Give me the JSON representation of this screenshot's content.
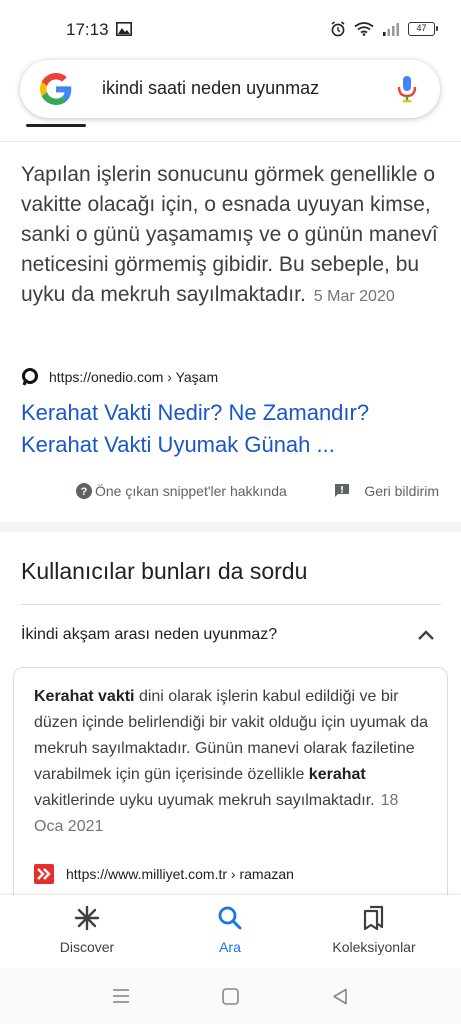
{
  "status_bar": {
    "time": "17:13",
    "battery": "47",
    "icons": [
      "image-icon",
      "alarm-icon",
      "wifi-icon",
      "signal-icon",
      "battery-icon"
    ]
  },
  "search": {
    "query": "ikindi saati neden uyunmaz",
    "logo": "google-g-logo",
    "mic": "mic-icon"
  },
  "featured_snippet": {
    "text": "Yapılan işlerin sonucunu görmek genellikle o vakitte olacağı için, o esnada uyuyan kimse, sanki o günü yaşamamış ve o günün manevî neticesini görmemiş gibidir. Bu sebeple, bu uyku da mekruh sayılmaktadır.",
    "date": "5 Mar 2020",
    "source_url": "https://onedio.com › Yaşam",
    "title": "Kerahat Vakti Nedir? Ne Zamandır? Kerahat Vakti Uyumak Günah ...",
    "about_label": "Öne çıkan snippet'ler hakkında",
    "feedback_label": "Geri bildirim"
  },
  "people_also_ask": {
    "title": "Kullanıcılar bunları da sordu",
    "question": "İkindi akşam arası neden uyunmaz?",
    "answer_b1": "Kerahat vakti",
    "answer_t1": " dini olarak işlerin kabul edildiği ve bir düzen içinde belirlendiği bir vakit olduğu için uyumak da mekruh sayılmaktadır. Günün manevi olarak faziletine varabilmek için gün içerisinde özellikle ",
    "answer_b2": "kerahat",
    "answer_t2": " vakitlerinde uyku uyumak mekruh sayılmaktadır.",
    "answer_date": "18 Oca 2021",
    "answer_source": "https://www.milliyet.com.tr › ramazan"
  },
  "bottom_nav": {
    "discover": "Discover",
    "search": "Ara",
    "collections": "Koleksiyonlar"
  },
  "colors": {
    "link": "#1a56c9",
    "active_tab": "#1a73e8"
  }
}
